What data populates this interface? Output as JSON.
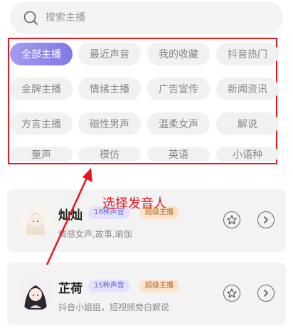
{
  "search": {
    "placeholder": "搜索主播"
  },
  "tags": [
    "全部主播",
    "最近声音",
    "我的收藏",
    "抖音热门",
    "金牌主播",
    "情绪主播",
    "广告宣传",
    "新闻资讯",
    "方言主播",
    "磁性男声",
    "温柔女声",
    "解说",
    "童声",
    "模仿",
    "英语",
    "小语种"
  ],
  "active_tag": "全部主播",
  "annotation": "选择发音人",
  "voices": [
    {
      "name": "灿灿",
      "count": "18种声音",
      "badge": "超级主播",
      "desc": "情感女声,故事,瑜伽"
    },
    {
      "name": "芷荷",
      "count": "15种声音",
      "badge": "超级主播",
      "desc": "抖音小姐姐，短视频旁白解说"
    }
  ],
  "colors": {
    "accent": "#7f78e6",
    "annotation_red": "#e8151b"
  }
}
